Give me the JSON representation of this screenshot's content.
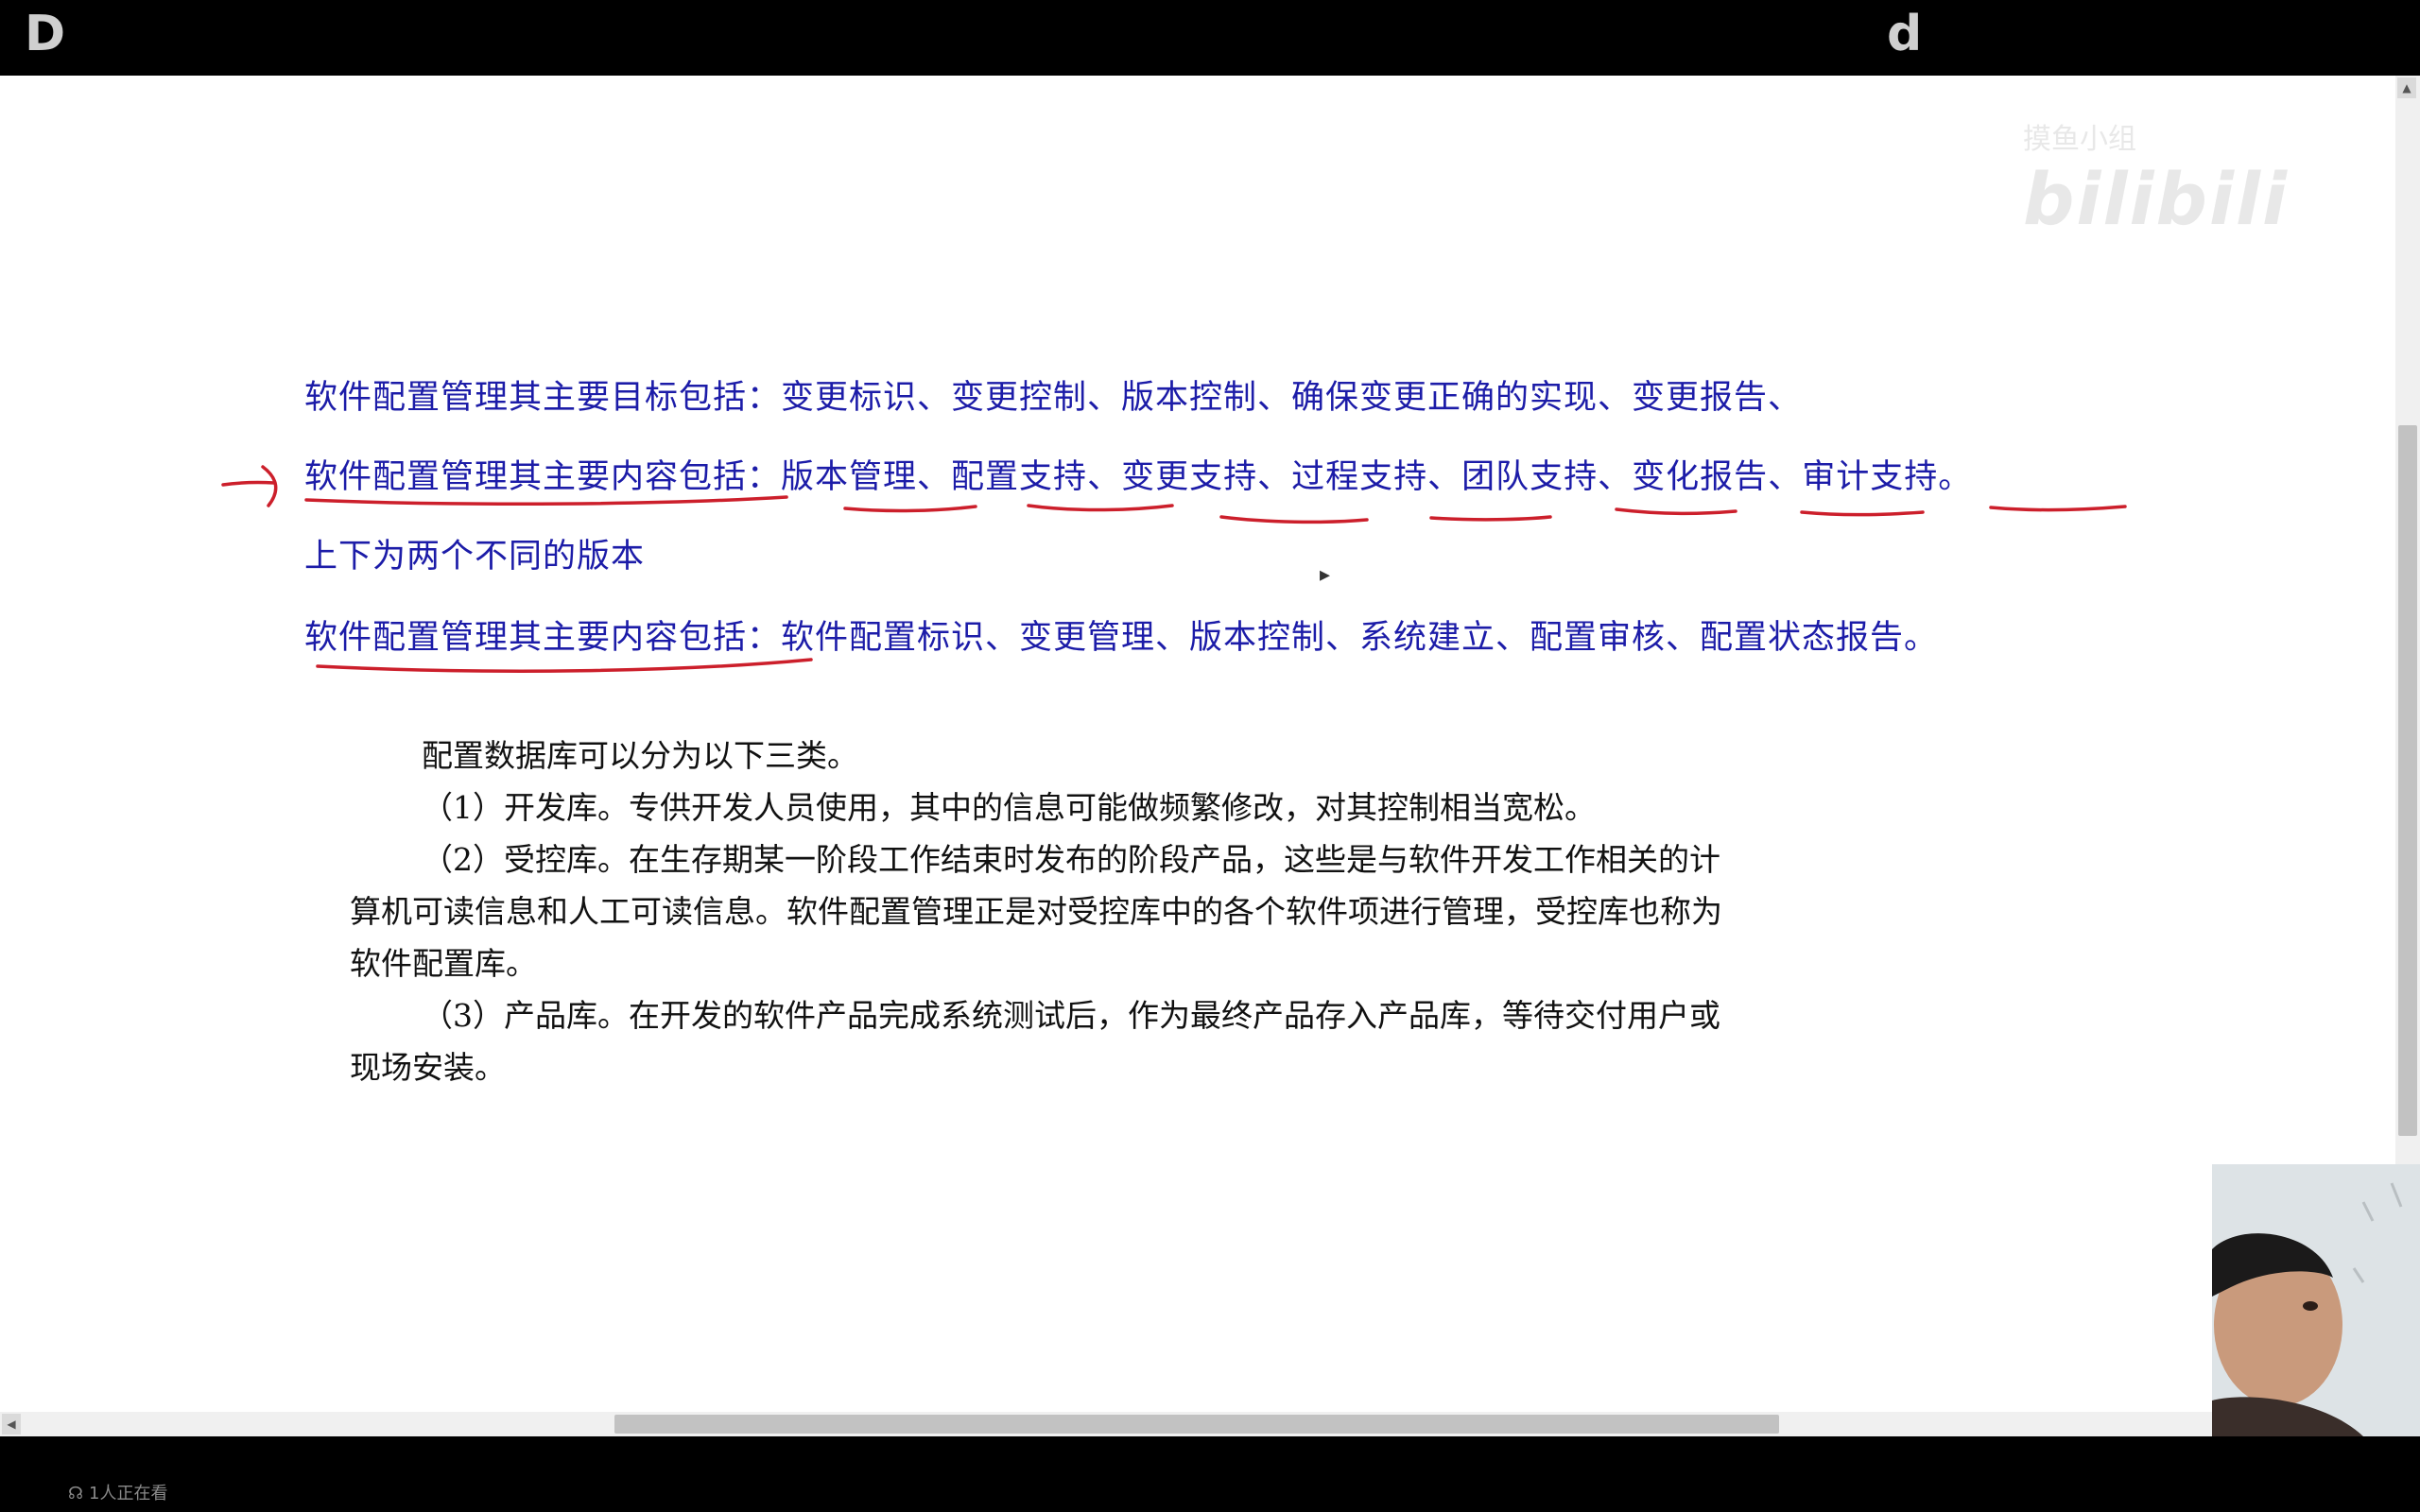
{
  "topbar": {
    "left_letter": "D",
    "right_letter": "d"
  },
  "watermark": {
    "small_text": "摸鱼小组",
    "logo_text": "bilibili"
  },
  "content": {
    "line1": "软件配置管理其主要目标包括：变更标识、变更控制、版本控制、确保变更正确的实现、变更报告、",
    "line2": {
      "prefix": "软件配置管理其主要内容包括：",
      "items": [
        "版本管理",
        "配置支持",
        "变更支持",
        "过程支持",
        "团队支持",
        "变化报告",
        "审计支持"
      ],
      "separator": "、",
      "end": "。"
    },
    "line3": "上下为两个不同的版本",
    "line4": {
      "prefix": "软件配置管理其主要内容包括：",
      "rest": "软件配置标识、变更管理、版本控制、系统建立、配置审核、配置状态报告。"
    },
    "body": {
      "intro": "配置数据库可以分为以下三类。",
      "p1": "（1）开发库。专供开发人员使用，其中的信息可能做频繁修改，对其控制相当宽松。",
      "p2": "（2）受控库。在生存期某一阶段工作结束时发布的阶段产品，这些是与软件开发工作相关的计算机可读信息和人工可读信息。软件配置管理正是对受控库中的各个软件项进行管理，受控库也称为软件配置库。",
      "p3": "（3）产品库。在开发的软件产品完成系统测试后，作为最终产品存入产品库，等待交付用户或现场安装。"
    },
    "annotation_color": "#cc1f2b",
    "text_color": "#1c1ca8"
  },
  "status": {
    "viewers": "1人正在看"
  },
  "icons": {
    "viewers_icon": "users-icon",
    "scroll_up": "chevron-up-icon",
    "scroll_left": "chevron-left-icon"
  }
}
